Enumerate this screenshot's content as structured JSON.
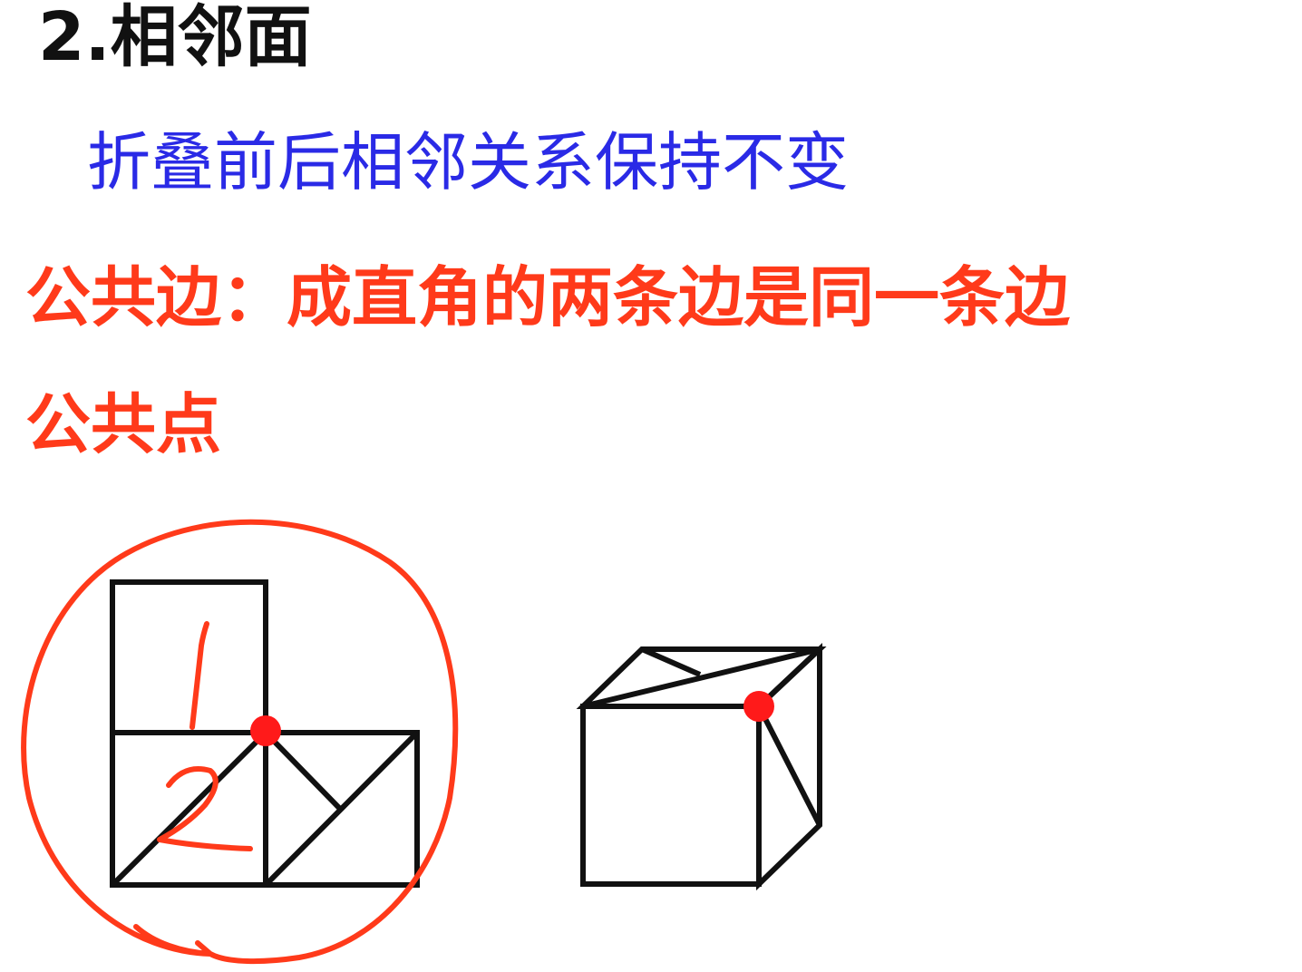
{
  "heading": {
    "title": "2.相邻面"
  },
  "rule": {
    "text": "折叠前后相邻关系保持不变"
  },
  "common_edge": {
    "text": "公共边：成直角的两条边是同一条边"
  },
  "common_point": {
    "text": "公共点"
  },
  "net_figure": {
    "face_labels": [
      "1",
      "2"
    ]
  },
  "colors": {
    "title": "#111111",
    "rule": "#2a2ae6",
    "highlight": "#ff3a1a",
    "stroke": "#111111",
    "dot": "#ff1a1a"
  }
}
